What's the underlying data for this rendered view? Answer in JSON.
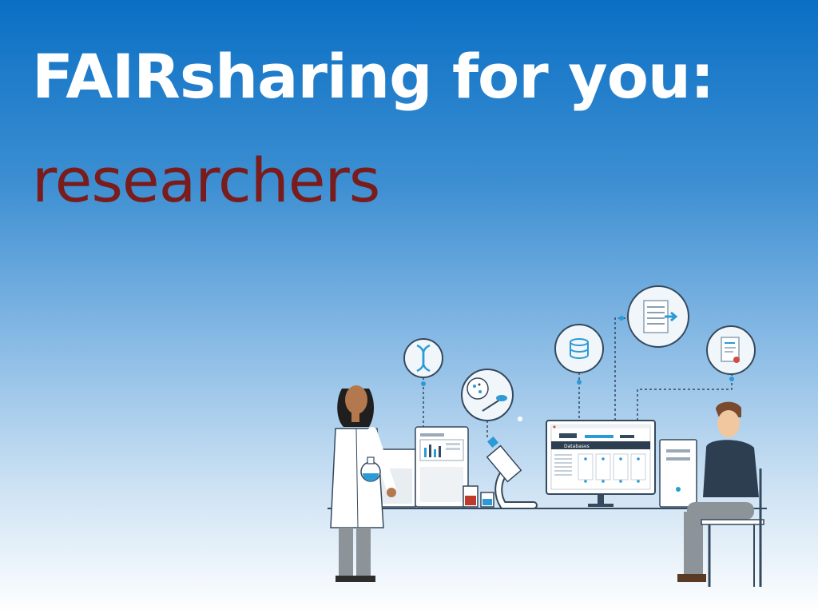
{
  "slide": {
    "title": "FAIRsharing for you:",
    "subtitle": "researchers"
  },
  "colors": {
    "background_top": "#0a6fc4",
    "background_bottom": "#ffffff",
    "title": "#ffffff",
    "subtitle": "#7a1c1c",
    "line_art": "#34495e",
    "accent": "#2b9ad6"
  },
  "illustration": {
    "monitor_screen_label": "Databases",
    "icons": [
      "dna-icon",
      "cell-culture-icon",
      "database-icon",
      "table-export-icon",
      "certificate-document-icon"
    ]
  }
}
